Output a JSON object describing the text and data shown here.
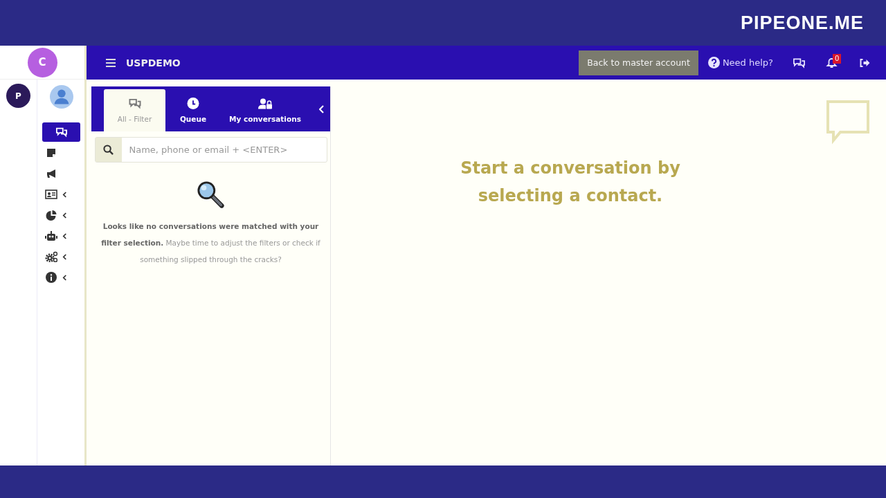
{
  "banner": {
    "brand": "PIPEONE.ME"
  },
  "workspace": {
    "avatar": "C",
    "account_avatar": "P"
  },
  "header": {
    "title": "USPDEMO",
    "back_button": "Back to master account",
    "help_link": "Need help?",
    "notifications": "0"
  },
  "sidebar": {
    "items": [
      {
        "kind": "chat",
        "selected": true,
        "submenu": false
      },
      {
        "kind": "note",
        "selected": false,
        "submenu": false
      },
      {
        "kind": "megaphone",
        "selected": false,
        "submenu": false
      },
      {
        "kind": "contact",
        "selected": false,
        "submenu": true
      },
      {
        "kind": "chart",
        "selected": false,
        "submenu": true
      },
      {
        "kind": "robot",
        "selected": false,
        "submenu": true
      },
      {
        "kind": "gears",
        "selected": false,
        "submenu": true
      },
      {
        "kind": "info",
        "selected": false,
        "submenu": true
      }
    ]
  },
  "conversations": {
    "tabs": [
      {
        "kind": "chat",
        "label": "All - Filter",
        "selected": true
      },
      {
        "kind": "clock",
        "label": "Queue",
        "selected": false
      },
      {
        "kind": "lock",
        "label": "My conversations",
        "selected": false
      }
    ],
    "search": {
      "placeholder": "Name, phone or email + <ENTER>"
    },
    "empty_message": "**Looks like no conversations were matched with your filter selection.** Maybe time to adjust the filters or check if something slipped through the cracks?"
  },
  "main": {
    "prompt": "Start a conversation by selecting a contact."
  }
}
